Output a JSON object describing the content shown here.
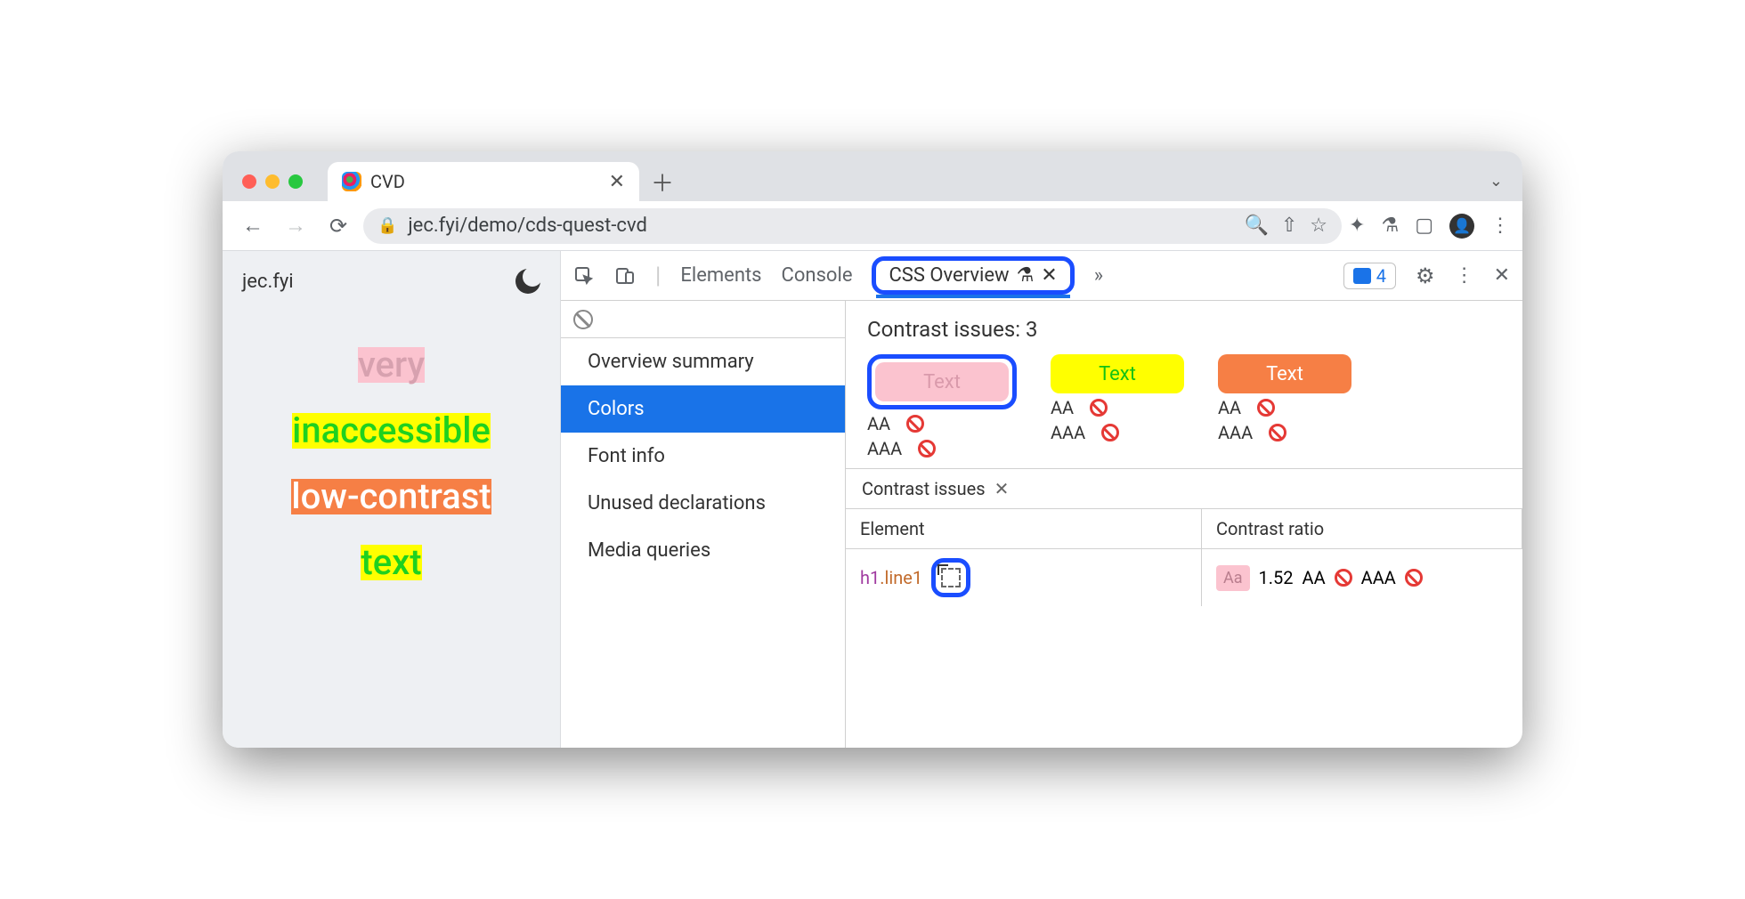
{
  "browser": {
    "tab_title": "CVD",
    "url_display": "jec.fyi/demo/cds-quest-cvd"
  },
  "page": {
    "site_label": "jec.fyi",
    "words": [
      "very",
      "inaccessible",
      "low-contrast",
      "text"
    ]
  },
  "devtools": {
    "tabs": {
      "elements": "Elements",
      "console": "Console",
      "css_overview": "CSS Overview",
      "more": "»"
    },
    "messages_count": "4",
    "sidebar": {
      "items": [
        "Overview summary",
        "Colors",
        "Font info",
        "Unused declarations",
        "Media queries"
      ],
      "selected_index": 1
    },
    "contrast": {
      "title_prefix": "Contrast issues: ",
      "count": "3",
      "swatch_label": "Text",
      "levels": {
        "aa": "AA",
        "aaa": "AAA"
      },
      "subtab": "Contrast issues",
      "table": {
        "col_element": "Element",
        "col_ratio": "Contrast ratio",
        "row": {
          "tag": "h1",
          "cls": ".line1",
          "badge": "Aa",
          "ratio": "1.52",
          "aa": "AA",
          "aaa": "AAA"
        }
      }
    }
  }
}
